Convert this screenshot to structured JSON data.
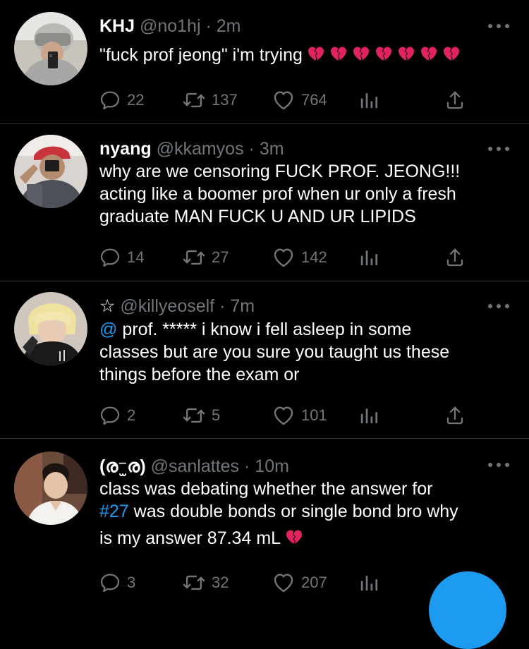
{
  "colors": {
    "background": "#000000",
    "text": "#ffffff",
    "muted": "#71767b",
    "accent": "#1d9bf0",
    "heart_emoji": "#e0245e"
  },
  "tweets": [
    {
      "name": "KHJ",
      "handle": "@no1hj",
      "dot": "·",
      "time": "2m",
      "body": "\"fuck prof jeong\" i'm trying",
      "broken_hearts": 7,
      "reply_count": "22",
      "retweet_count": "137",
      "like_count": "764"
    },
    {
      "name": "nyang",
      "handle": "@kkamyos",
      "dot": "·",
      "time": "3m",
      "body_lines": [
        "why are we censoring FUCK PROF. JEONG!!!",
        "acting like a boomer prof when ur only a fresh",
        "graduate MAN FUCK U AND UR LIPIDS"
      ],
      "reply_count": "14",
      "retweet_count": "27",
      "like_count": "142"
    },
    {
      "name": "☆",
      "handle": "@killyeoself",
      "dot": "·",
      "time": "7m",
      "mention": "@",
      "body_line1_rest": " prof. ***** i know i fell asleep in some",
      "body_lines_rest": [
        "classes but are you sure you taught us these",
        "things before the exam or"
      ],
      "reply_count": "2",
      "retweet_count": "5",
      "like_count": "101"
    },
    {
      "name": "(ര⁻̫ര)",
      "handle": "@sanlattes",
      "dot": "·",
      "time": "10m",
      "body_line1": "class was debating whether the answer for",
      "hashtag": "#27",
      "body_line2_rest": " was double bonds or single bond bro why",
      "body_line3": "is my answer 87.34 mL",
      "broken_hearts": 1,
      "reply_count": "3",
      "retweet_count": "32",
      "like_count": "207"
    }
  ],
  "icons": {
    "reply": "reply-icon",
    "retweet": "retweet-icon",
    "like": "heart-icon",
    "analytics": "analytics-icon",
    "share": "share-icon",
    "more": "more-icon",
    "broken_heart": "broken-heart-emoji-icon"
  }
}
